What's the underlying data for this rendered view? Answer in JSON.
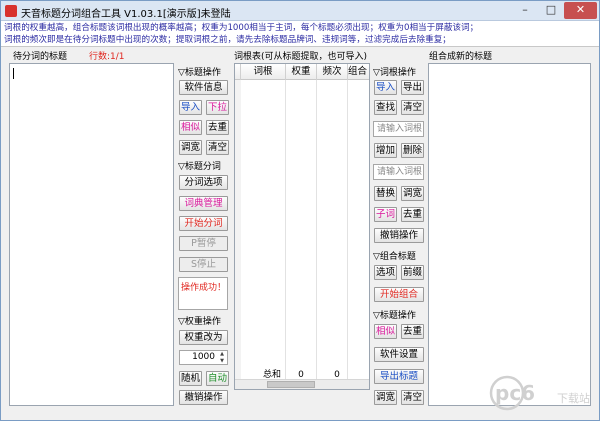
{
  "window": {
    "title": "天音标题分词组合工具 V1.03.1[演示版]未登陆",
    "min_glyph": "–",
    "max_glyph": "□",
    "close_glyph": "✕"
  },
  "info": {
    "line1": "词根的权重越高，组合标题该词根出现的概率越高；权重为1000相当于主词，每个标题必须出现；权重为0相当于屏蔽该词；",
    "line2": "词根的频次即是在待分词标题中出现的次数；提取词根之前，请先去除标题品牌词、违规词等，过滤完成后去除重复；"
  },
  "left": {
    "title": "待分词的标题",
    "row_count": "行数:1/1"
  },
  "middle": {
    "title": "词根表(可从标题提取，也可导入)",
    "columns": [
      "词根",
      "权重",
      "频次",
      "组合"
    ],
    "footer": {
      "label": "总和",
      "weight": "0",
      "freq": "0"
    }
  },
  "right": {
    "title": "组合成新的标题"
  },
  "panel1": {
    "title_ops": "▽标题操作",
    "software_info": "软件信息",
    "import": "导入",
    "dropdown": "下拉",
    "similar": "相似",
    "dedupe": "去重",
    "widen": "调宽",
    "clear": "清空",
    "seg_title": "▽标题分词",
    "seg_options": "分词选项",
    "dict_manage": "词典管理",
    "start_seg": "开始分词",
    "pause": "P暂停",
    "stop": "S停止",
    "status": "操作成功！",
    "weight_ops": "▽权重操作",
    "weight_change": "权重改为",
    "weight_value": "1000",
    "random": "随机",
    "auto": "自动",
    "undo": "撤销操作"
  },
  "panel2": {
    "root_ops": "▽词根操作",
    "import": "导入",
    "export": "导出",
    "find": "查找",
    "clear": "清空",
    "root_placeholder": "请输入词根",
    "add": "增加",
    "delete": "删除",
    "root_placeholder2": "请输入词根",
    "replace": "替换",
    "widen": "调宽",
    "subword": "子词",
    "dedupe": "去重",
    "undo": "撤销操作",
    "combine_title": "▽组合标题",
    "options": "选项",
    "prefix": "前缀",
    "start_combine": "开始组合",
    "title_ops": "▽标题操作",
    "similar": "相似",
    "dedupe2": "去重",
    "settings": "软件设置",
    "export_title": "导出标题",
    "widen2": "调宽",
    "clear2": "清空"
  },
  "watermark": {
    "brand": "pc6",
    "sub": "下载站"
  }
}
